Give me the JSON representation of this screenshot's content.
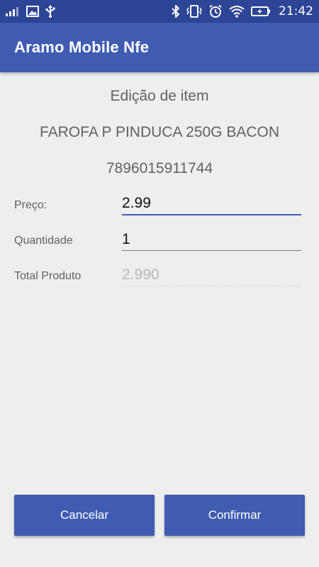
{
  "status_bar": {
    "time": "21:42",
    "icons": [
      "signal-icon",
      "image-icon",
      "usb-icon",
      "bluetooth-icon",
      "vibrate-icon",
      "alarm-icon",
      "wifi-icon",
      "battery-charging-icon"
    ]
  },
  "app_bar": {
    "title": "Aramo Mobile Nfe"
  },
  "screen": {
    "title": "Edição de item",
    "product_name": "FAROFA P PINDUCA 250G BACON",
    "product_code": "7896015911744"
  },
  "form": {
    "price_label": "Preço:",
    "price_value": "2.99",
    "quantity_label": "Quantidade",
    "quantity_value": "1",
    "total_label": "Total Produto",
    "total_value": "2.990"
  },
  "buttons": {
    "cancel_label": "Cancelar",
    "confirm_label": "Confirmar"
  },
  "colors": {
    "status_bar": "#2c4596",
    "app_bar": "#3f5cb2",
    "background": "#eeeeee",
    "accent": "#3f5cb2"
  }
}
